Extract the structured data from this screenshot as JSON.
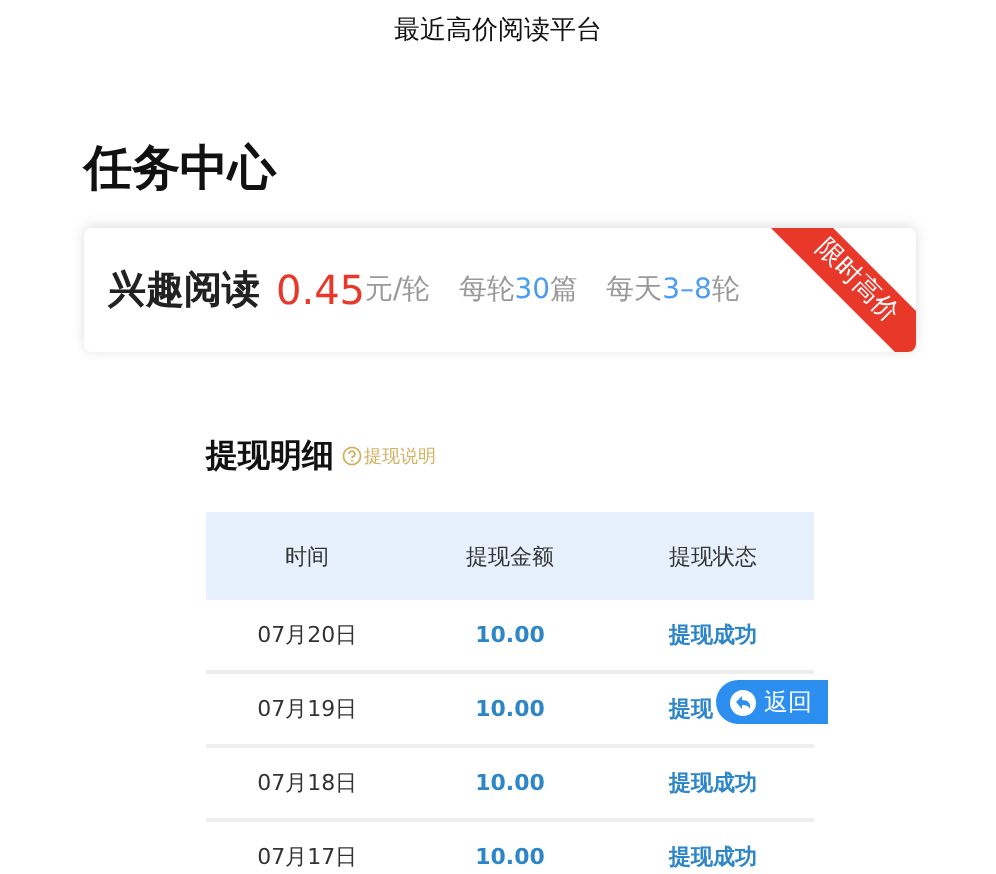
{
  "page_title": "最近高价阅读平台",
  "section_title": "任务中心",
  "task_card": {
    "name": "兴趣阅读",
    "price": "0.45",
    "unit": "元/轮",
    "rounds": {
      "prefix": "每轮",
      "value": "30",
      "suffix": "篇"
    },
    "daily": {
      "prefix": "每天",
      "value": "3–8",
      "suffix": "轮"
    },
    "ribbon": "限时高价"
  },
  "withdrawals": {
    "title": "提现明细",
    "help_link": "提现说明",
    "columns": [
      "时间",
      "提现金额",
      "提现状态"
    ],
    "rows": [
      {
        "date": "07月20日",
        "amount": "10.00",
        "status": "提现成功"
      },
      {
        "date": "07月19日",
        "amount": "10.00",
        "status": "提现"
      },
      {
        "date": "07月18日",
        "amount": "10.00",
        "status": "提现成功"
      },
      {
        "date": "07月17日",
        "amount": "10.00",
        "status": "提现成功"
      }
    ]
  },
  "back_button": "返回"
}
